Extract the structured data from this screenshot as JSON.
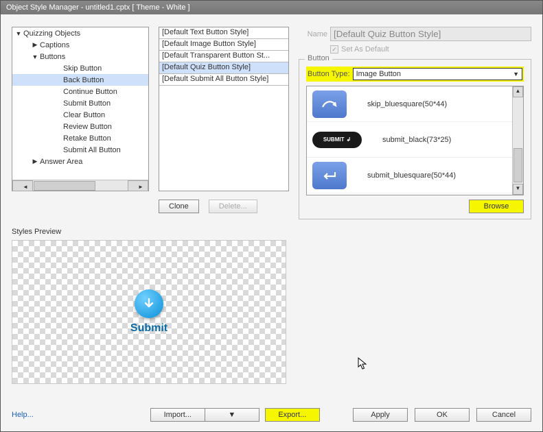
{
  "title": "Object Style Manager - untitled1.cptx [ Theme - White ]",
  "tree": {
    "root": "Quizzing Objects",
    "captions": "Captions",
    "buttons": "Buttons",
    "skip": "Skip Button",
    "back": "Back Button",
    "continue": "Continue Button",
    "submit": "Submit Button",
    "clear": "Clear Button",
    "review": "Review Button",
    "retake": "Retake Button",
    "submit_all": "Submit All Button",
    "answer_area": "Answer Area"
  },
  "styles": [
    "[Default Text Button Style]",
    "[Default Image Button Style]",
    "[Default Transparent Button St...",
    "[Default Quiz Button Style]",
    "[Default Submit All Button Style]"
  ],
  "clone": "Clone",
  "delete": "Delete...",
  "name_label": "Name",
  "name_value": "[Default Quiz Button Style]",
  "set_default": "Set As Default",
  "button_group": "Button",
  "button_type_label": "Button Type:",
  "button_type_value": "Image Button",
  "image_options": [
    "skip_bluesquare(50*44)",
    "submit_black(73*25)",
    "submit_bluesquare(50*44)"
  ],
  "browse": "Browse",
  "preview_label": "Styles Preview",
  "submit_preview": "Submit",
  "help": "Help...",
  "import": "Import...",
  "export": "Export...",
  "apply": "Apply",
  "ok": "OK",
  "cancel": "Cancel",
  "thumb_submit_text": "SUBMIT"
}
